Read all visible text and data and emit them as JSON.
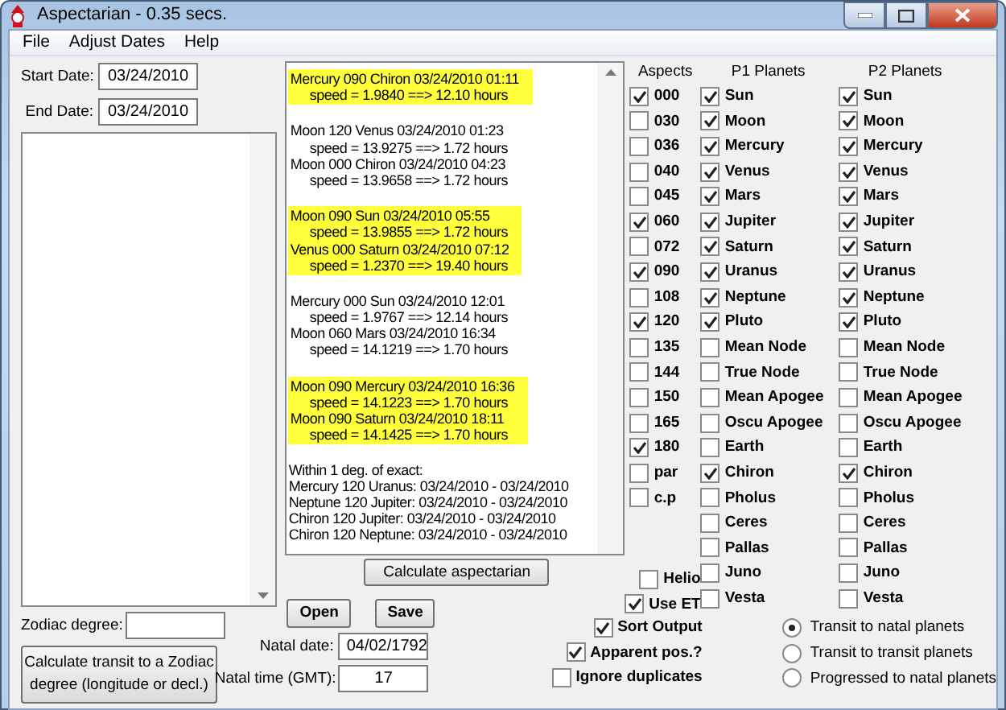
{
  "window": {
    "title": "Aspectarian - 0.35 secs."
  },
  "menu": [
    "File",
    "Adjust Dates",
    "Help"
  ],
  "start_date": {
    "label": "Start Date:",
    "value": "03/24/2010"
  },
  "end_date": {
    "label": "End Date:",
    "value": "03/24/2010"
  },
  "zodiac_degree": {
    "label": "Zodiac degree:"
  },
  "zodiac_button": "Calculate transit to a Zodiac degree (longitude or decl.)",
  "output": {
    "blocks": [
      {
        "highlighted": true,
        "entries": [
          {
            "event": "Mercury 090 Chiron 03/24/2010 01:11",
            "speed": "speed = 1.9840 ==> 12.10 hours"
          }
        ]
      },
      {
        "highlighted": false,
        "entries": [
          {
            "event": "Moon 120 Venus 03/24/2010 01:23",
            "speed": "speed = 13.9275 ==> 1.72 hours"
          },
          {
            "event": "Moon 000 Chiron 03/24/2010 04:23",
            "speed": "speed = 13.9658 ==> 1.72 hours"
          }
        ]
      },
      {
        "highlighted": true,
        "entries": [
          {
            "event": "Moon 090 Sun 03/24/2010 05:55",
            "speed": "speed = 13.9855 ==> 1.72 hours"
          },
          {
            "event": "Venus 000 Saturn 03/24/2010 07:12",
            "speed": "speed = 1.2370 ==> 19.40 hours"
          }
        ]
      },
      {
        "highlighted": false,
        "entries": [
          {
            "event": "Mercury 000 Sun 03/24/2010 12:01",
            "speed": "speed = 1.9767 ==> 12.14 hours"
          },
          {
            "event": "Moon 060 Mars 03/24/2010 16:34",
            "speed": "speed = 14.1219 ==> 1.70 hours"
          }
        ]
      },
      {
        "highlighted": true,
        "entries": [
          {
            "event": "Moon 090 Mercury 03/24/2010 16:36",
            "speed": "speed = 14.1223 ==> 1.70 hours"
          },
          {
            "event": "Moon 090 Saturn 03/24/2010 18:11",
            "speed": "speed = 14.1425 ==> 1.70 hours"
          }
        ]
      }
    ],
    "summary": {
      "heading": "Within 1 deg. of exact:",
      "lines": [
        "Mercury 120 Uranus: 03/24/2010 - 03/24/2010",
        "Neptune 120 Jupiter: 03/24/2010 - 03/24/2010",
        "Chiron 120 Jupiter: 03/24/2010 - 03/24/2010",
        "Chiron 120 Neptune: 03/24/2010 - 03/24/2010"
      ]
    }
  },
  "calculate_button": "Calculate aspectarian",
  "open_button": "Open",
  "save_button": "Save",
  "natal_date": {
    "label": "Natal date:",
    "value": "04/02/1792"
  },
  "natal_time": {
    "label": "Natal time (GMT):",
    "value": "17"
  },
  "aspects": {
    "heading": "Aspects",
    "items": [
      {
        "label": "000",
        "checked": true
      },
      {
        "label": "030",
        "checked": false
      },
      {
        "label": "036",
        "checked": false
      },
      {
        "label": "040",
        "checked": false
      },
      {
        "label": "045",
        "checked": false
      },
      {
        "label": "060",
        "checked": true
      },
      {
        "label": "072",
        "checked": false
      },
      {
        "label": "090",
        "checked": true
      },
      {
        "label": "108",
        "checked": false
      },
      {
        "label": "120",
        "checked": true
      },
      {
        "label": "135",
        "checked": false
      },
      {
        "label": "144",
        "checked": false
      },
      {
        "label": "150",
        "checked": false
      },
      {
        "label": "165",
        "checked": false
      },
      {
        "label": "180",
        "checked": true
      },
      {
        "label": "par",
        "checked": false
      },
      {
        "label": "c.p",
        "checked": false
      }
    ]
  },
  "p1_planets": {
    "heading": "P1 Planets",
    "items": [
      {
        "label": "Sun",
        "checked": true
      },
      {
        "label": "Moon",
        "checked": true
      },
      {
        "label": "Mercury",
        "checked": true
      },
      {
        "label": "Venus",
        "checked": true
      },
      {
        "label": "Mars",
        "checked": true
      },
      {
        "label": "Jupiter",
        "checked": true
      },
      {
        "label": "Saturn",
        "checked": true
      },
      {
        "label": "Uranus",
        "checked": true
      },
      {
        "label": "Neptune",
        "checked": true
      },
      {
        "label": "Pluto",
        "checked": true
      },
      {
        "label": "Mean Node",
        "checked": false
      },
      {
        "label": "True Node",
        "checked": false
      },
      {
        "label": "Mean Apogee",
        "checked": false
      },
      {
        "label": "Oscu Apogee",
        "checked": false
      },
      {
        "label": "Earth",
        "checked": false
      },
      {
        "label": "Chiron",
        "checked": true
      },
      {
        "label": "Pholus",
        "checked": false
      },
      {
        "label": "Ceres",
        "checked": false
      },
      {
        "label": "Pallas",
        "checked": false
      },
      {
        "label": "Juno",
        "checked": false
      },
      {
        "label": "Vesta",
        "checked": false
      }
    ]
  },
  "p2_planets": {
    "heading": "P2 Planets",
    "items": [
      {
        "label": "Sun",
        "checked": true
      },
      {
        "label": "Moon",
        "checked": true
      },
      {
        "label": "Mercury",
        "checked": true
      },
      {
        "label": "Venus",
        "checked": true
      },
      {
        "label": "Mars",
        "checked": true
      },
      {
        "label": "Jupiter",
        "checked": true
      },
      {
        "label": "Saturn",
        "checked": true
      },
      {
        "label": "Uranus",
        "checked": true
      },
      {
        "label": "Neptune",
        "checked": true
      },
      {
        "label": "Pluto",
        "checked": true
      },
      {
        "label": "Mean Node",
        "checked": false
      },
      {
        "label": "True Node",
        "checked": false
      },
      {
        "label": "Mean Apogee",
        "checked": false
      },
      {
        "label": "Oscu Apogee",
        "checked": false
      },
      {
        "label": "Earth",
        "checked": false
      },
      {
        "label": "Chiron",
        "checked": true
      },
      {
        "label": "Pholus",
        "checked": false
      },
      {
        "label": "Ceres",
        "checked": false
      },
      {
        "label": "Pallas",
        "checked": false
      },
      {
        "label": "Juno",
        "checked": false
      },
      {
        "label": "Vesta",
        "checked": false
      }
    ]
  },
  "side_options": [
    {
      "label": "Helio",
      "checked": false
    },
    {
      "label": "Use ET",
      "checked": true
    }
  ],
  "options": [
    {
      "label": "Sort Output",
      "checked": true
    },
    {
      "label": "Apparent pos.?",
      "checked": true
    },
    {
      "label": "Ignore duplicates",
      "checked": false
    }
  ],
  "modes": [
    {
      "label": "Transit to natal planets",
      "selected": true
    },
    {
      "label": "Transit to transit planets",
      "selected": false
    },
    {
      "label": "Progressed to natal planets",
      "selected": false
    }
  ]
}
